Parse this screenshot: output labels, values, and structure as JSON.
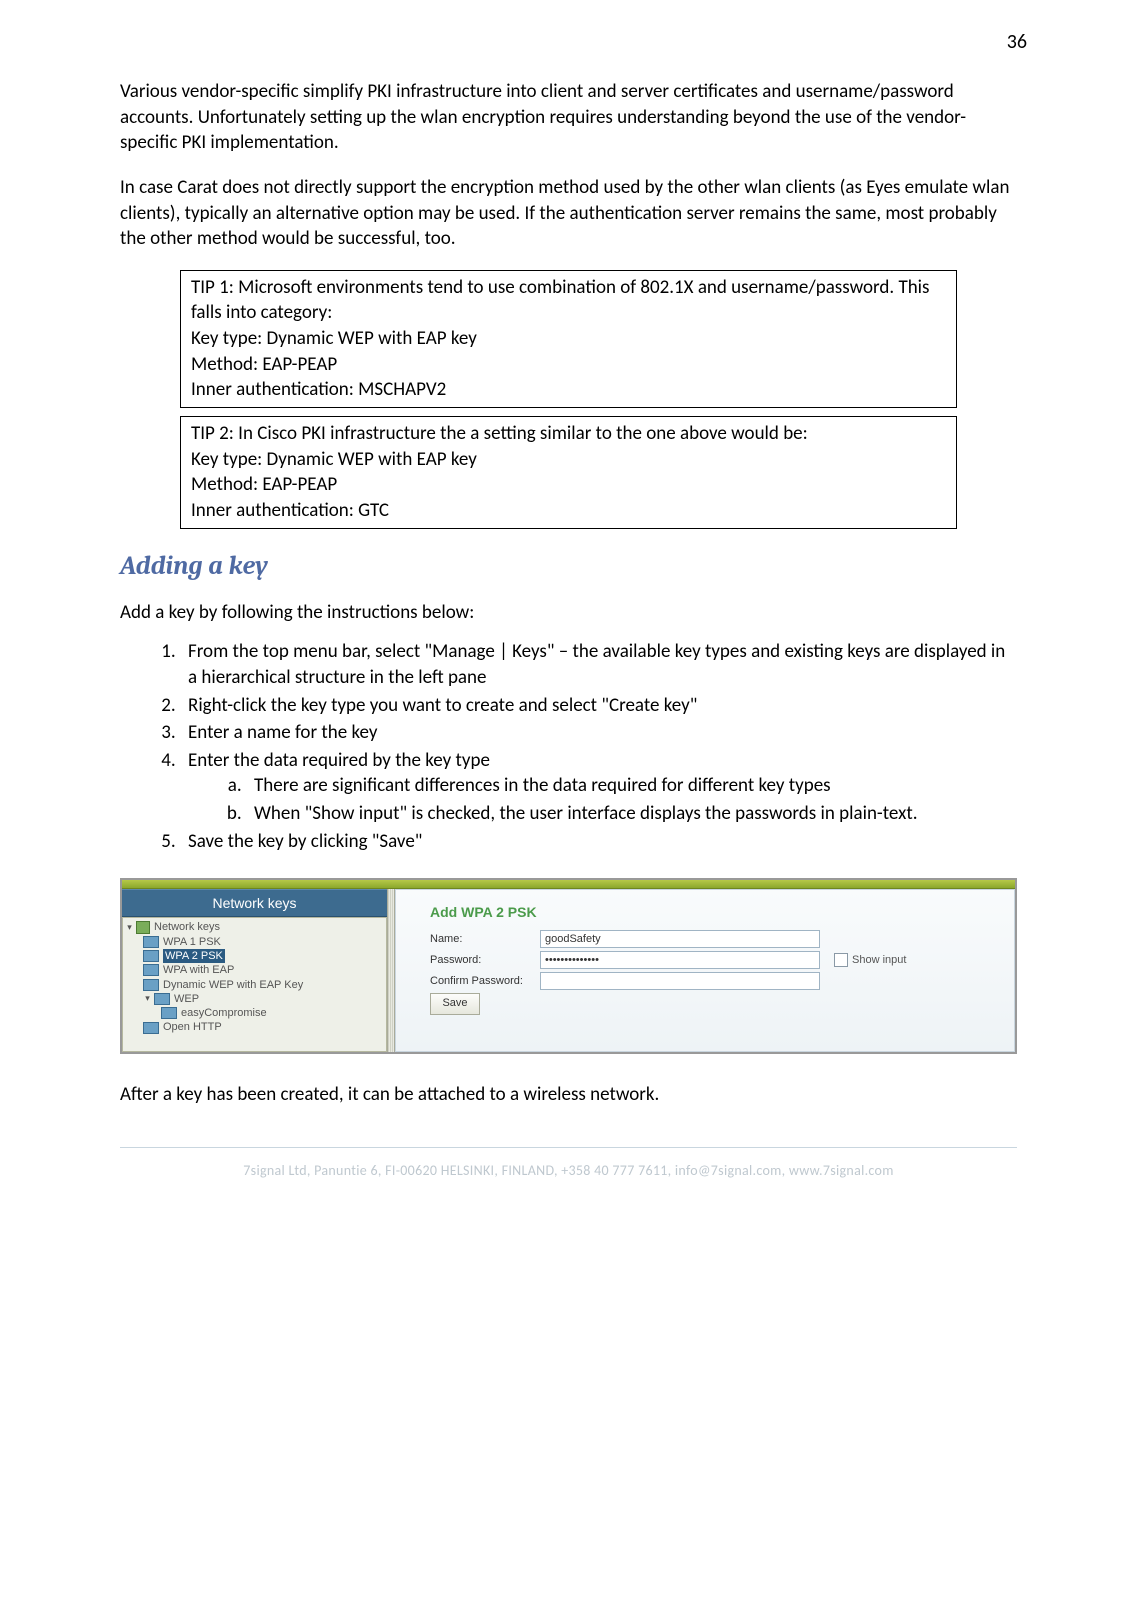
{
  "page_number": "36",
  "paragraph1": "Various vendor-specific simplify PKI infrastructure into client and server certificates and username/password accounts. Unfortunately setting up the wlan encryption requires understanding beyond the use of the vendor-specific PKI implementation.",
  "paragraph2": "In case Carat does not directly support the encryption method used by the other wlan clients (as Eyes emulate wlan clients), typically an alternative option may be used. If the authentication server remains the same, most probably the other method would be successful, too.",
  "tip1": {
    "line1": "TIP 1: Microsoft environments tend to use combination of 802.1X and username/password. This falls into category:",
    "line2": "Key type: Dynamic WEP with EAP key",
    "line3": "Method: EAP-PEAP",
    "line4": "Inner authentication: MSCHAPV2"
  },
  "tip2": {
    "line1": "TIP 2: In Cisco PKI infrastructure the a setting similar to the one above would be:",
    "line2": "Key type: Dynamic WEP with EAP key",
    "line3": "Method: EAP-PEAP",
    "line4": "Inner authentication: GTC"
  },
  "heading": "Adding a key",
  "instruction_lead": "Add a key by following the instructions below:",
  "steps": {
    "s1": "From the top menu bar, select \"Manage | Keys\" – the available key types and existing keys are displayed in a hierarchical structure in the left pane",
    "s2": "Right-click the key type you want to create and select \"Create key\"",
    "s3": "Enter a name for the key",
    "s4": "Enter the data required by the key type",
    "s4a": "There are significant differences in the data required for different key types",
    "s4b": "When \"Show input\" is checked, the user interface displays the passwords in plain-text.",
    "s5": "Save the key by clicking \"Save\""
  },
  "screenshot": {
    "panel_title": "Network keys",
    "tree": {
      "root": "Network keys",
      "item1": "WPA 1 PSK",
      "item2": "WPA 2 PSK",
      "item3": "WPA with EAP",
      "item4": "Dynamic WEP with EAP Key",
      "item5": "WEP",
      "item5a": "easyCompromise",
      "item6": "Open HTTP"
    },
    "form": {
      "title": "Add WPA 2 PSK",
      "name_label": "Name:",
      "name_value": "goodSafety",
      "password_label": "Password:",
      "password_value": "••••••••••••••",
      "confirm_label": "Confirm Password:",
      "confirm_value": "",
      "show_input_label": "Show input",
      "save_label": "Save"
    }
  },
  "after_paragraph": "After a key has been created, it can be attached to a wireless network.",
  "footer": "7signal Ltd, Panuntie 6, FI-00620 HELSINKI, FINLAND, +358 40 777 7611, info@7signal.com, www.7signal.com"
}
